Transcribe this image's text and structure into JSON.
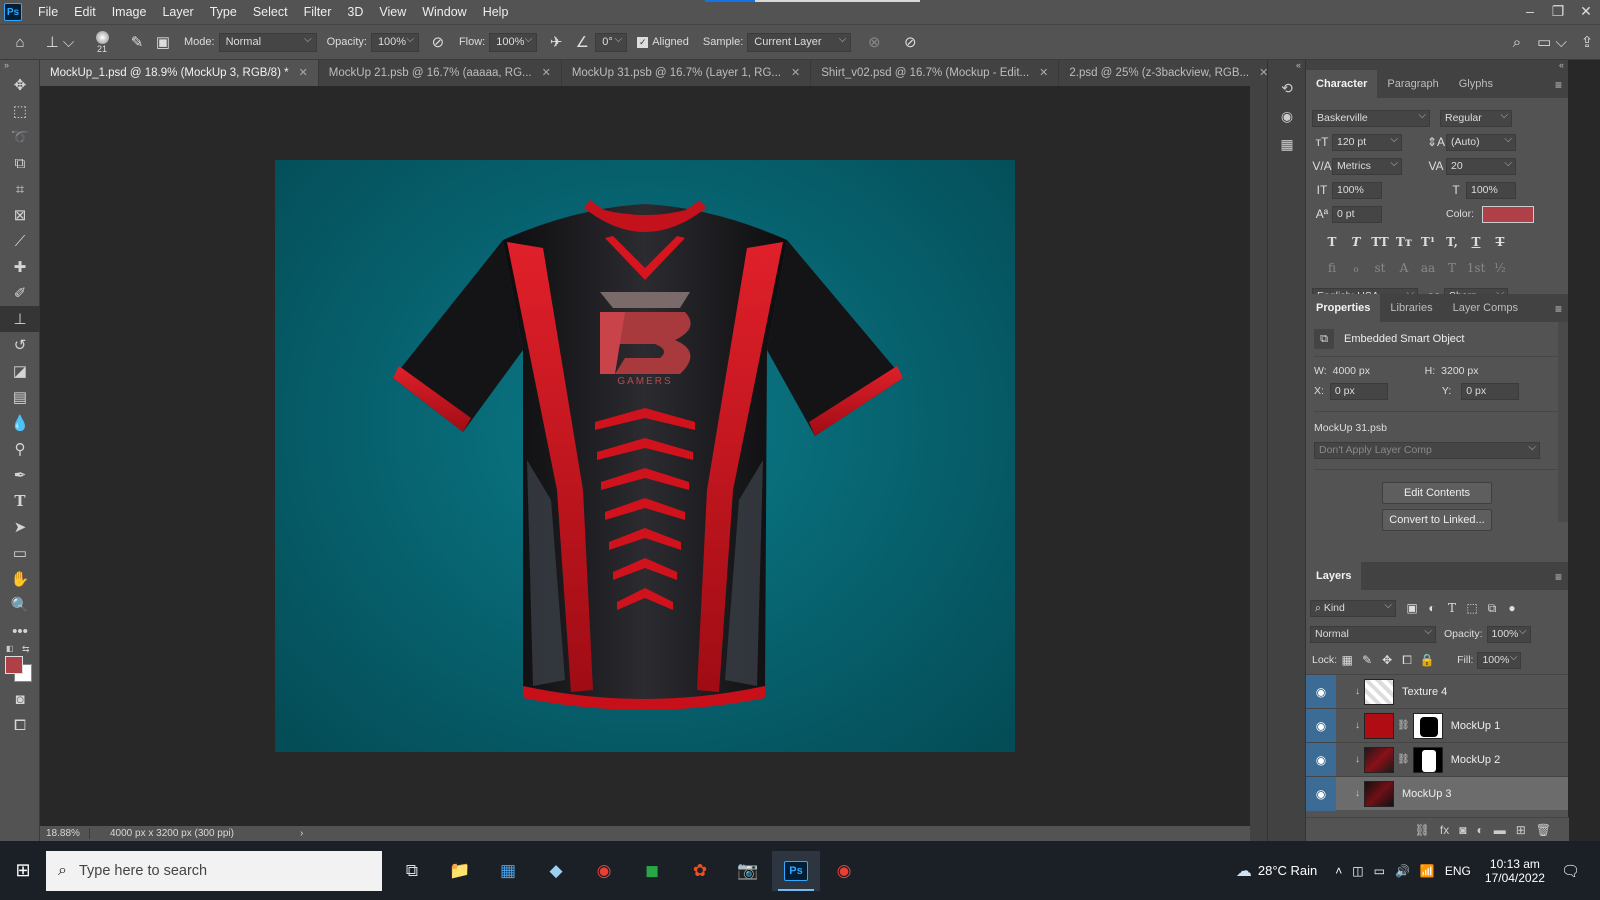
{
  "app": {
    "logo": "Ps"
  },
  "menu": [
    "File",
    "Edit",
    "Image",
    "Layer",
    "Type",
    "Select",
    "Filter",
    "3D",
    "View",
    "Window",
    "Help"
  ],
  "options": {
    "brush_size": "21",
    "mode_label": "Mode:",
    "mode_value": "Normal",
    "opacity_label": "Opacity:",
    "opacity_value": "100%",
    "flow_label": "Flow:",
    "flow_value": "100%",
    "angle_value": "0°",
    "aligned_label": "Aligned",
    "sample_label": "Sample:",
    "sample_value": "Current Layer"
  },
  "tabs": [
    {
      "label": "MockUp_1.psd @ 18.9% (MockUp 3, RGB/8) *"
    },
    {
      "label": "MockUp 21.psb @ 16.7% (aaaaa, RG..."
    },
    {
      "label": "MockUp 31.psb @ 16.7% (Layer 1, RG..."
    },
    {
      "label": "Shirt_v02.psd @ 16.7% (Mockup - Edit..."
    },
    {
      "label": "2.psd @ 25% (z-3backview, RGB..."
    }
  ],
  "artwork": {
    "logo_text": "GAMERS"
  },
  "status": {
    "zoom": "18.88%",
    "doc_size": "4000 px x 3200 px (300 ppi)"
  },
  "character": {
    "tabs": [
      "Character",
      "Paragraph",
      "Glyphs"
    ],
    "font_family": "Baskerville",
    "font_style": "Regular",
    "size": "120 pt",
    "leading": "(Auto)",
    "kerning": "Metrics",
    "tracking": "20",
    "vscale": "100%",
    "hscale": "100%",
    "baseline": "0 pt",
    "color_label": "Color:",
    "color": "#b04048",
    "style_buttons": [
      "T",
      "T",
      "TT",
      "Tт",
      "T¹",
      "T,",
      "T",
      "T"
    ],
    "opentype_buttons": [
      "fi",
      "ℴ",
      "st",
      "A",
      "aa",
      "T",
      "1st",
      "½"
    ],
    "language": "English: USA",
    "antialias_icon": "aa",
    "antialias": "Sharp"
  },
  "properties": {
    "tabs": [
      "Properties",
      "Libraries",
      "Layer Comps"
    ],
    "type_label": "Embedded Smart Object",
    "w_label": "W:",
    "w_value": "4000 px",
    "h_label": "H:",
    "h_value": "3200 px",
    "x_label": "X:",
    "x_value": "0 px",
    "y_label": "Y:",
    "y_value": "0 px",
    "filename": "MockUp 31.psb",
    "layer_comp": "Don't Apply Layer Comp",
    "edit_button": "Edit Contents",
    "convert_button": "Convert to Linked..."
  },
  "layers": {
    "title": "Layers",
    "filter": "Kind",
    "blend": "Normal",
    "opacity_label": "Opacity:",
    "opacity_value": "100%",
    "lock_label": "Lock:",
    "fill_label": "Fill:",
    "fill_value": "100%",
    "items": [
      {
        "name": "Texture 4",
        "selected": false
      },
      {
        "name": "MockUp 1",
        "selected": false
      },
      {
        "name": "MockUp 2",
        "selected": false
      },
      {
        "name": "MockUp 3",
        "selected": true
      }
    ]
  },
  "taskbar": {
    "search_placeholder": "Type here to search",
    "weather": "28°C  Rain",
    "lang": "ENG",
    "time": "10:13 am",
    "date": "17/04/2022"
  }
}
